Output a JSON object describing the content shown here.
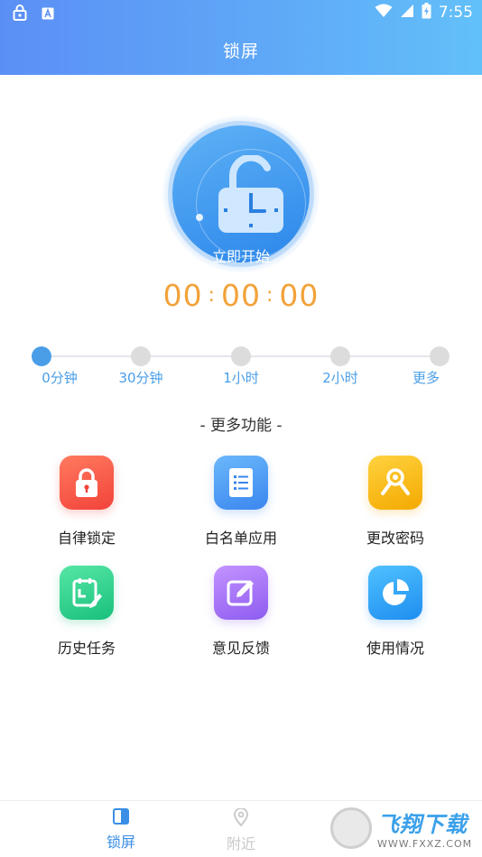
{
  "status_bar": {
    "time": "7:55",
    "icons": [
      "lock-icon",
      "a-notification-icon",
      "wifi-icon",
      "signal-icon",
      "battery-icon"
    ]
  },
  "header": {
    "title": "锁屏"
  },
  "lock": {
    "start_label": "立即开始"
  },
  "timer": {
    "hours": "00",
    "minutes": "00",
    "seconds": "00",
    "separator": ":"
  },
  "duration_slider": {
    "selected_index": 0,
    "options": [
      {
        "label": "0分钟"
      },
      {
        "label": "30分钟"
      },
      {
        "label": "1小时"
      },
      {
        "label": "2小时"
      },
      {
        "label": "更多"
      }
    ]
  },
  "more_features": {
    "title": "- 更多功能 -",
    "items": [
      {
        "label": "自律锁定",
        "icon": "padlock-icon",
        "color": "#f2433a"
      },
      {
        "label": "白名单应用",
        "icon": "list-icon",
        "color": "#3a86ef"
      },
      {
        "label": "更改密码",
        "icon": "key-icon",
        "color": "#f4a900"
      },
      {
        "label": "历史任务",
        "icon": "calendar-edit-icon",
        "color": "#18c07d"
      },
      {
        "label": "意见反馈",
        "icon": "edit-icon",
        "color": "#8d5cf0"
      },
      {
        "label": "使用情况",
        "icon": "pie-chart-icon",
        "color": "#1e8ef0"
      }
    ]
  },
  "bottom_nav": {
    "items": [
      {
        "label": "锁屏",
        "icon": "lockscreen-tab-icon",
        "active": true
      },
      {
        "label": "附近",
        "icon": "location-pin-icon",
        "active": false
      }
    ]
  },
  "watermark": {
    "main": "飞翔下载",
    "sub": "WWW.FXXZ.COM"
  },
  "colors": {
    "accent": "#3a8ee6",
    "timer": "#f2a23a",
    "header_start": "#5b8ff5",
    "header_end": "#62c0f9"
  }
}
